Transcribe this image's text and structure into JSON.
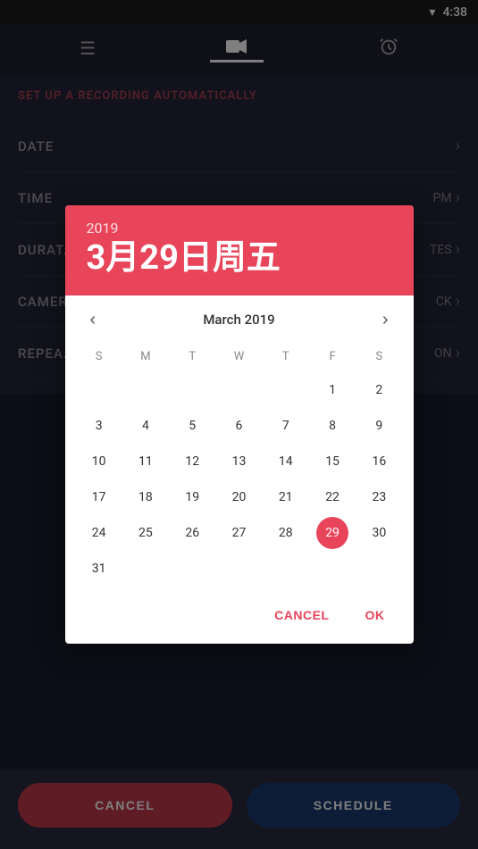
{
  "statusBar": {
    "time": "4:38",
    "wifiIcon": "▼"
  },
  "navBar": {
    "menuIcon": "☰",
    "videoIcon": "📹",
    "alarmIcon": "⏰"
  },
  "background": {
    "sectionTitle": "SET UP A RECORDING AUTOMATICALLY",
    "rows": [
      {
        "label": "DATE",
        "value": "",
        "hasChevron": true
      },
      {
        "label": "TIME",
        "value": "PM",
        "hasChevron": true
      },
      {
        "label": "DURAT",
        "value": "TES",
        "hasChevron": true
      },
      {
        "label": "CAMER",
        "value": "CK",
        "hasChevron": true
      },
      {
        "label": "REPEA",
        "value": "ON",
        "hasChevron": true
      }
    ]
  },
  "dialog": {
    "year": "2019",
    "dateTitle": "3月29日周五",
    "monthLabel": "March 2019",
    "prevBtn": "‹",
    "nextBtn": "›",
    "weekdays": [
      "S",
      "M",
      "T",
      "W",
      "T",
      "F",
      "S"
    ],
    "days": [
      {
        "val": "",
        "empty": true
      },
      {
        "val": "",
        "empty": true
      },
      {
        "val": "",
        "empty": true
      },
      {
        "val": "",
        "empty": true
      },
      {
        "val": "",
        "empty": true
      },
      {
        "val": "1",
        "empty": false
      },
      {
        "val": "2",
        "empty": false
      },
      {
        "val": "3",
        "empty": false
      },
      {
        "val": "4",
        "empty": false
      },
      {
        "val": "5",
        "empty": false
      },
      {
        "val": "6",
        "empty": false
      },
      {
        "val": "7",
        "empty": false
      },
      {
        "val": "8",
        "empty": false
      },
      {
        "val": "9",
        "empty": false
      },
      {
        "val": "10",
        "empty": false
      },
      {
        "val": "11",
        "empty": false
      },
      {
        "val": "12",
        "empty": false
      },
      {
        "val": "13",
        "empty": false
      },
      {
        "val": "14",
        "empty": false
      },
      {
        "val": "15",
        "empty": false
      },
      {
        "val": "16",
        "empty": false
      },
      {
        "val": "17",
        "empty": false
      },
      {
        "val": "18",
        "empty": false
      },
      {
        "val": "19",
        "empty": false
      },
      {
        "val": "20",
        "empty": false
      },
      {
        "val": "21",
        "empty": false
      },
      {
        "val": "22",
        "empty": false
      },
      {
        "val": "23",
        "empty": false
      },
      {
        "val": "24",
        "empty": false
      },
      {
        "val": "25",
        "empty": false
      },
      {
        "val": "26",
        "empty": false
      },
      {
        "val": "27",
        "empty": false
      },
      {
        "val": "28",
        "empty": false
      },
      {
        "val": "29",
        "empty": false,
        "selected": true
      },
      {
        "val": "30",
        "empty": false
      },
      {
        "val": "31",
        "empty": false
      }
    ],
    "cancelLabel": "CANCEL",
    "okLabel": "OK"
  },
  "bottomBar": {
    "cancelLabel": "CANCEL",
    "scheduleLabel": "SCHEDULE"
  },
  "colors": {
    "accent": "#e8445a",
    "darkBlue": "#1a3a6e"
  }
}
